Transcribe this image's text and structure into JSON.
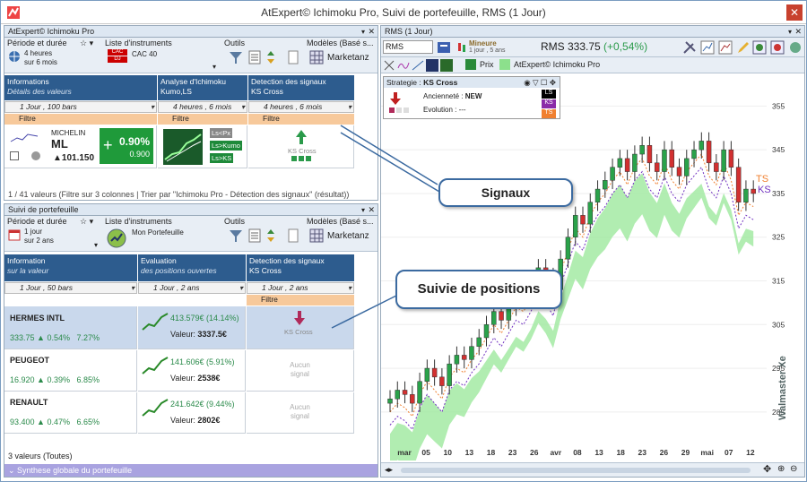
{
  "window": {
    "title": "AtExpert© Ichimoku Pro, Suivi de portefeuille, RMS (1 Jour)"
  },
  "top_pane": {
    "title": "AtExpert© Ichimoku Pro",
    "toolbar": {
      "period_label": "Période et durée",
      "period_value1": "4 heures",
      "period_value2": "sur 6 mois",
      "instruments_label": "Liste d'instruments",
      "instrument_value": "CAC 40",
      "instrument_flags": [
        "CAC",
        "DJ"
      ],
      "tools_label": "Outils",
      "models_label": "Modèles (Basé s...",
      "models_value": "Marketanz"
    },
    "columns": [
      {
        "title": "Informations",
        "subtitle": "Détails des valeurs",
        "period": "1 Jour , 100 bars"
      },
      {
        "title": "Analyse d'Ichimoku",
        "subtitle": "Kumo,LS",
        "period": "4 heures , 6 mois"
      },
      {
        "title": "Detection des signaux",
        "subtitle": "KS Cross",
        "period": "4 heures , 6 mois"
      }
    ],
    "filter_label": "Filtre",
    "row": {
      "name": "MICHELIN",
      "ticker": "ML",
      "price": "101.150",
      "pct": "0.90%",
      "change": "0.900",
      "plus": "+",
      "analysis_buttons": [
        "Ls<Px",
        "Ls>Kumo",
        "Ls>KS"
      ],
      "signal": "KS Cross"
    },
    "status": "1 / 41 valeurs (Filtre sur 3 colonnes | Trier par \"Ichimoku Pro - Détection des signaux\" (résultat))"
  },
  "bottom_pane": {
    "title": "Suivi de portefeuille",
    "toolbar": {
      "period_label": "Période et durée",
      "period_value1": "1 jour",
      "period_value2": "sur 2 ans",
      "instruments_label": "Liste d'instruments",
      "instrument_value": "Mon Portefeuille",
      "tools_label": "Outils",
      "models_label": "Modèles (Basé s...",
      "models_value": "Marketanz"
    },
    "columns": [
      {
        "title": "Information",
        "subtitle": "sur la valeur",
        "period": "1 Jour , 50 bars"
      },
      {
        "title": "Evaluation",
        "subtitle": "des positions ouvertes",
        "period": "1 Jour , 2 ans"
      },
      {
        "title": "Detection des signaux",
        "subtitle": "KS Cross",
        "period": "1 Jour , 2 ans"
      }
    ],
    "filter_label": "Filtre",
    "rows": [
      {
        "name": "HERMES INTL",
        "price": "333.75",
        "pct": "0.54%",
        "pct2": "7.27%",
        "eval": "413.579€ (14.14%)",
        "valeur_label": "Valeur:",
        "valeur": "3337.5€",
        "signal": "KS Cross"
      },
      {
        "name": "PEUGEOT",
        "price": "16.920",
        "pct": "0.39%",
        "pct2": "6.85%",
        "eval": "141.606€ (5.91%)",
        "valeur_label": "Valeur:",
        "valeur": "2538€",
        "signal1": "Aucun",
        "signal2": "signal"
      },
      {
        "name": "RENAULT",
        "price": "93.400",
        "pct": "0.47%",
        "pct2": "6.65%",
        "eval": "241.642€ (9.44%)",
        "valeur_label": "Valeur:",
        "valeur": "2802€",
        "signal1": "Aucun",
        "signal2": "signal"
      }
    ],
    "status": "3 valeurs (Toutes)",
    "synthese": "Synthese globale du portefeuille"
  },
  "chart_pane": {
    "title": "RMS (1 Jour)",
    "symbol": "RMS",
    "mineure": "Mineure",
    "mineure_sub": "1 jour , 5 ans",
    "quote": "RMS 333.75",
    "quote_change": "(+0,54%)",
    "prix_label": "Prix",
    "indicator_label": "AtExpert© Ichimoku Pro",
    "strategy_label": "Strategie :",
    "strategy_value": "KS Cross",
    "anciennete_label": "Ancienneté :",
    "anciennete_value": "NEW",
    "evolution_label": "Evolution :",
    "evolution_value": "---",
    "badges": [
      "LS",
      "KS",
      "TS"
    ],
    "watermark": "Walmaster Xe",
    "line_labels": [
      "TS",
      "KS"
    ]
  },
  "callouts": {
    "signaux": "Signaux",
    "positions": "Suivie de positions"
  },
  "chart_data": {
    "type": "candlestick",
    "y_ticks": [
      285,
      295,
      305,
      315,
      325,
      335,
      345,
      355
    ],
    "ylim": [
      278,
      360
    ],
    "x_ticks": [
      "mar",
      "05",
      "10",
      "13",
      "18",
      "23",
      "26",
      "avr",
      "08",
      "13",
      "18",
      "23",
      "26",
      "29",
      "mai",
      "07",
      "12"
    ],
    "colors": {
      "up": "#2aa24a",
      "down": "#d23030",
      "cloud_up": "#9ee89e",
      "cloud_down": "#f2a0a0",
      "ks": "#7030c0",
      "ts": "#f08030"
    },
    "closes": [
      288,
      290,
      289,
      287,
      292,
      295,
      293,
      291,
      296,
      298,
      297,
      300,
      302,
      305,
      308,
      306,
      309,
      312,
      311,
      314,
      318,
      316,
      313,
      320,
      325,
      330,
      328,
      333,
      336,
      338,
      341,
      343,
      340,
      344,
      346,
      342,
      340,
      345,
      341,
      339,
      343,
      345,
      347,
      342,
      340,
      345,
      341,
      333,
      336,
      335
    ]
  }
}
